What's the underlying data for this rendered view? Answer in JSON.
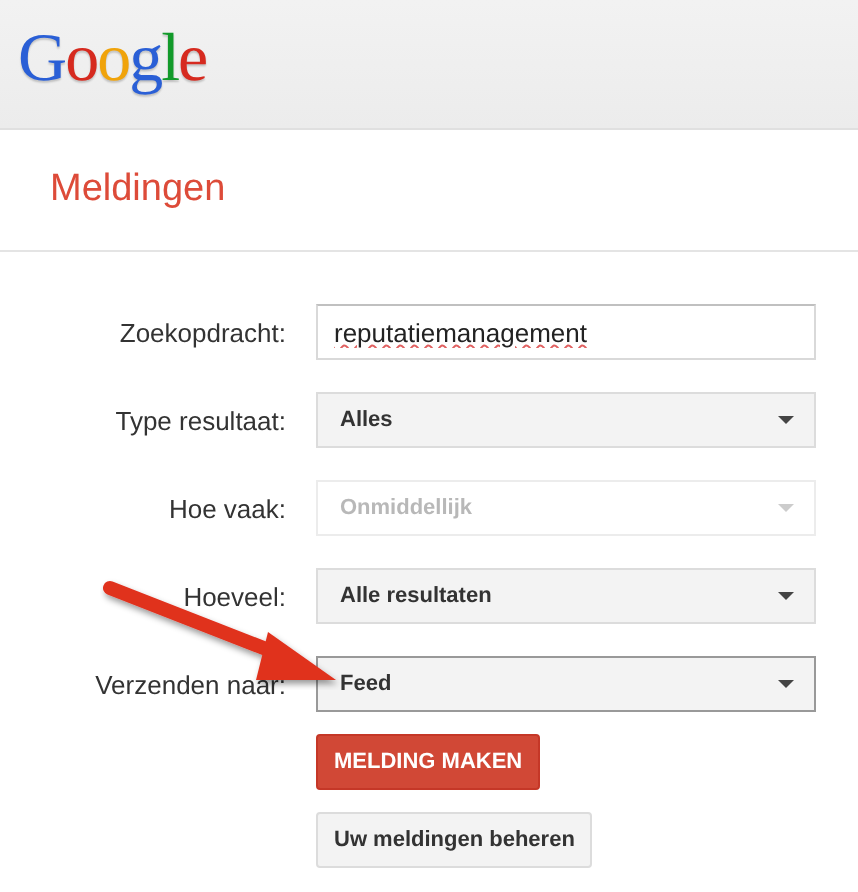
{
  "logo": "Google",
  "title": "Meldingen",
  "fields": [
    {
      "kind": "text",
      "label": "Zoekopdracht:",
      "value": "reputatiemanagement"
    },
    {
      "kind": "select",
      "label": "Type resultaat:",
      "value": "Alles",
      "disabled": false,
      "focused": false
    },
    {
      "kind": "select",
      "label": "Hoe vaak:",
      "value": "Onmiddellijk",
      "disabled": true,
      "focused": false
    },
    {
      "kind": "select",
      "label": "Hoeveel:",
      "value": "Alle resultaten",
      "disabled": false,
      "focused": false
    },
    {
      "kind": "select",
      "label": "Verzenden naar:",
      "value": "Feed",
      "disabled": false,
      "focused": true
    }
  ],
  "buttons": [
    {
      "kind": "primary",
      "label": "MELDING MAKEN"
    },
    {
      "kind": "secondary",
      "label": "Uw meldingen beheren"
    }
  ]
}
